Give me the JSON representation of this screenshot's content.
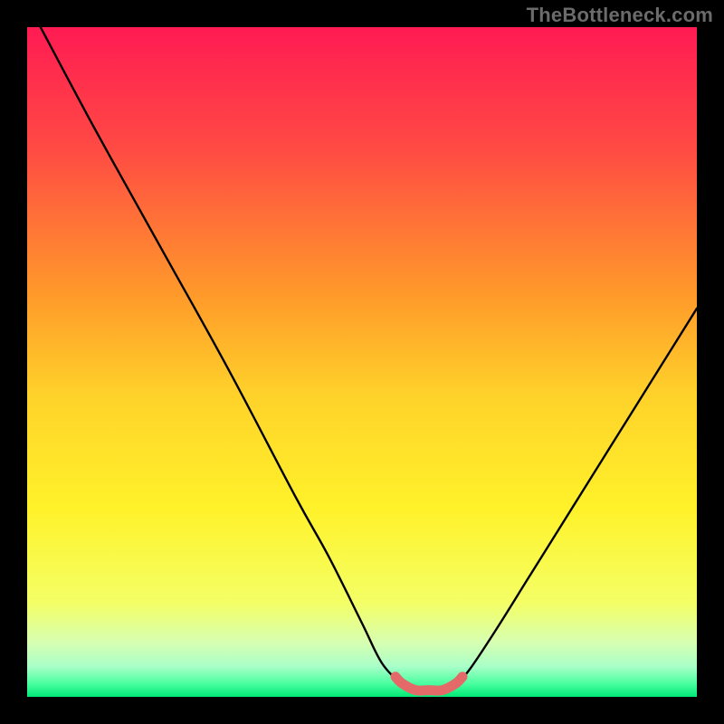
{
  "watermark": "TheBottleneck.com",
  "chart_data": {
    "type": "line",
    "title": "",
    "xlabel": "",
    "ylabel": "",
    "xlim": [
      0,
      1
    ],
    "ylim": [
      0,
      1
    ],
    "series": [
      {
        "name": "bottleneck-curve",
        "x": [
          0.02,
          0.1,
          0.2,
          0.3,
          0.4,
          0.45,
          0.5,
          0.53,
          0.56,
          0.58,
          0.6,
          0.62,
          0.64,
          0.66,
          0.7,
          0.75,
          0.8,
          0.85,
          0.9,
          0.95,
          1.0
        ],
        "y": [
          1.0,
          0.85,
          0.67,
          0.49,
          0.3,
          0.21,
          0.11,
          0.05,
          0.02,
          0.01,
          0.01,
          0.01,
          0.02,
          0.04,
          0.1,
          0.18,
          0.26,
          0.34,
          0.42,
          0.5,
          0.58
        ]
      },
      {
        "name": "minimum-highlight",
        "x": [
          0.55,
          0.56,
          0.58,
          0.6,
          0.62,
          0.64,
          0.65
        ],
        "y": [
          0.03,
          0.02,
          0.01,
          0.01,
          0.01,
          0.02,
          0.03
        ]
      }
    ],
    "gradient_stops": [
      {
        "pos": 0.0,
        "color": "#ff1b53"
      },
      {
        "pos": 0.18,
        "color": "#ff4a44"
      },
      {
        "pos": 0.4,
        "color": "#ff9a2a"
      },
      {
        "pos": 0.55,
        "color": "#ffd22a"
      },
      {
        "pos": 0.72,
        "color": "#fff22a"
      },
      {
        "pos": 0.86,
        "color": "#f4ff66"
      },
      {
        "pos": 0.92,
        "color": "#d6ffb3"
      },
      {
        "pos": 0.955,
        "color": "#a8ffc8"
      },
      {
        "pos": 0.98,
        "color": "#4bffa0"
      },
      {
        "pos": 1.0,
        "color": "#00e876"
      }
    ]
  }
}
